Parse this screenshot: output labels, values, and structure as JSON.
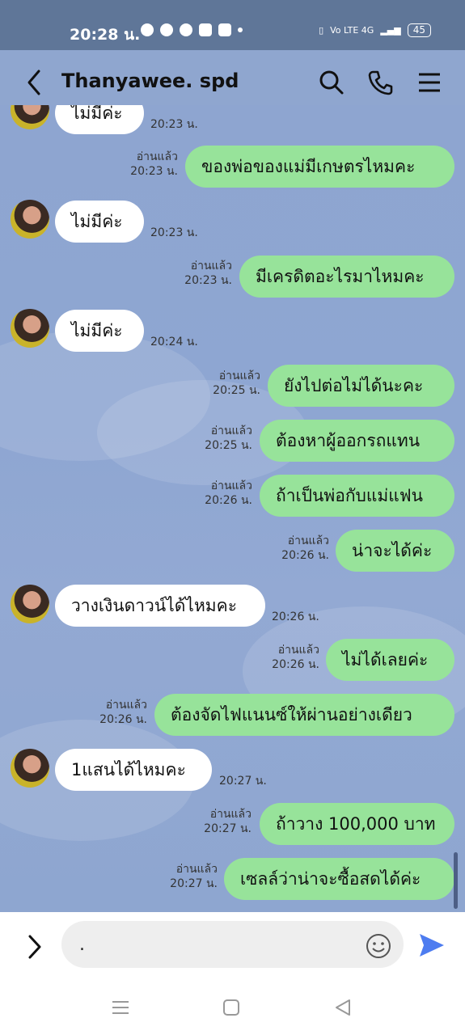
{
  "status": {
    "time": "20:28 น.",
    "battery": "45",
    "network": "Vo LTE 4G"
  },
  "header": {
    "title": "Thanyawee. spd"
  },
  "messages": [
    {
      "dir": "in",
      "text": "ไม่มีค่ะ",
      "time": "20:23 น."
    },
    {
      "dir": "out",
      "text": "ของพ่อของแม่มีเกษตรไหมคะ",
      "read": "อ่านแล้ว",
      "time": "20:23 น."
    },
    {
      "dir": "in",
      "text": "ไม่มีค่ะ",
      "time": "20:23 น."
    },
    {
      "dir": "out",
      "text": "มีเครดิตอะไรมาไหมคะ",
      "read": "อ่านแล้ว",
      "time": "20:23 น."
    },
    {
      "dir": "in",
      "text": "ไม่มีค่ะ",
      "time": "20:24 น."
    },
    {
      "dir": "out",
      "text": "ยังไปต่อไม่ได้นะคะ",
      "read": "อ่านแล้ว",
      "time": "20:25 น."
    },
    {
      "dir": "out",
      "text": "ต้องหาผู้ออกรถแทน",
      "read": "อ่านแล้ว",
      "time": "20:25 น."
    },
    {
      "dir": "out",
      "text": "ถ้าเป็นพ่อกับแม่แฟน",
      "read": "อ่านแล้ว",
      "time": "20:26 น."
    },
    {
      "dir": "out",
      "text": "น่าจะได้ค่ะ",
      "read": "อ่านแล้ว",
      "time": "20:26 น."
    },
    {
      "dir": "in",
      "text": "วางเงินดาวน์ได้ไหมคะ",
      "time": "20:26 น."
    },
    {
      "dir": "out",
      "text": "ไม่ได้เลยค่ะ",
      "read": "อ่านแล้ว",
      "time": "20:26 น."
    },
    {
      "dir": "out",
      "text": "ต้องจัดไฟแนนซ์ให้ผ่านอย่างเดียว",
      "read": "อ่านแล้ว",
      "time": "20:26 น."
    },
    {
      "dir": "in",
      "text": "1แสนได้ไหมคะ",
      "time": "20:27 น."
    },
    {
      "dir": "out",
      "text": "ถ้าวาง 100,000 บาท",
      "read": "อ่านแล้ว",
      "time": "20:27 น."
    },
    {
      "dir": "out",
      "text": "เซลล์ว่าน่าจะซื้อสดได้ค่ะ",
      "read": "อ่านแล้ว",
      "time": "20:27 น."
    }
  ],
  "input": {
    "value": "."
  },
  "colors": {
    "outgoing_bubble": "#97e39a",
    "incoming_bubble": "#ffffff",
    "chat_background": "#8fa6cf",
    "send_icon": "#4d7cf0"
  }
}
